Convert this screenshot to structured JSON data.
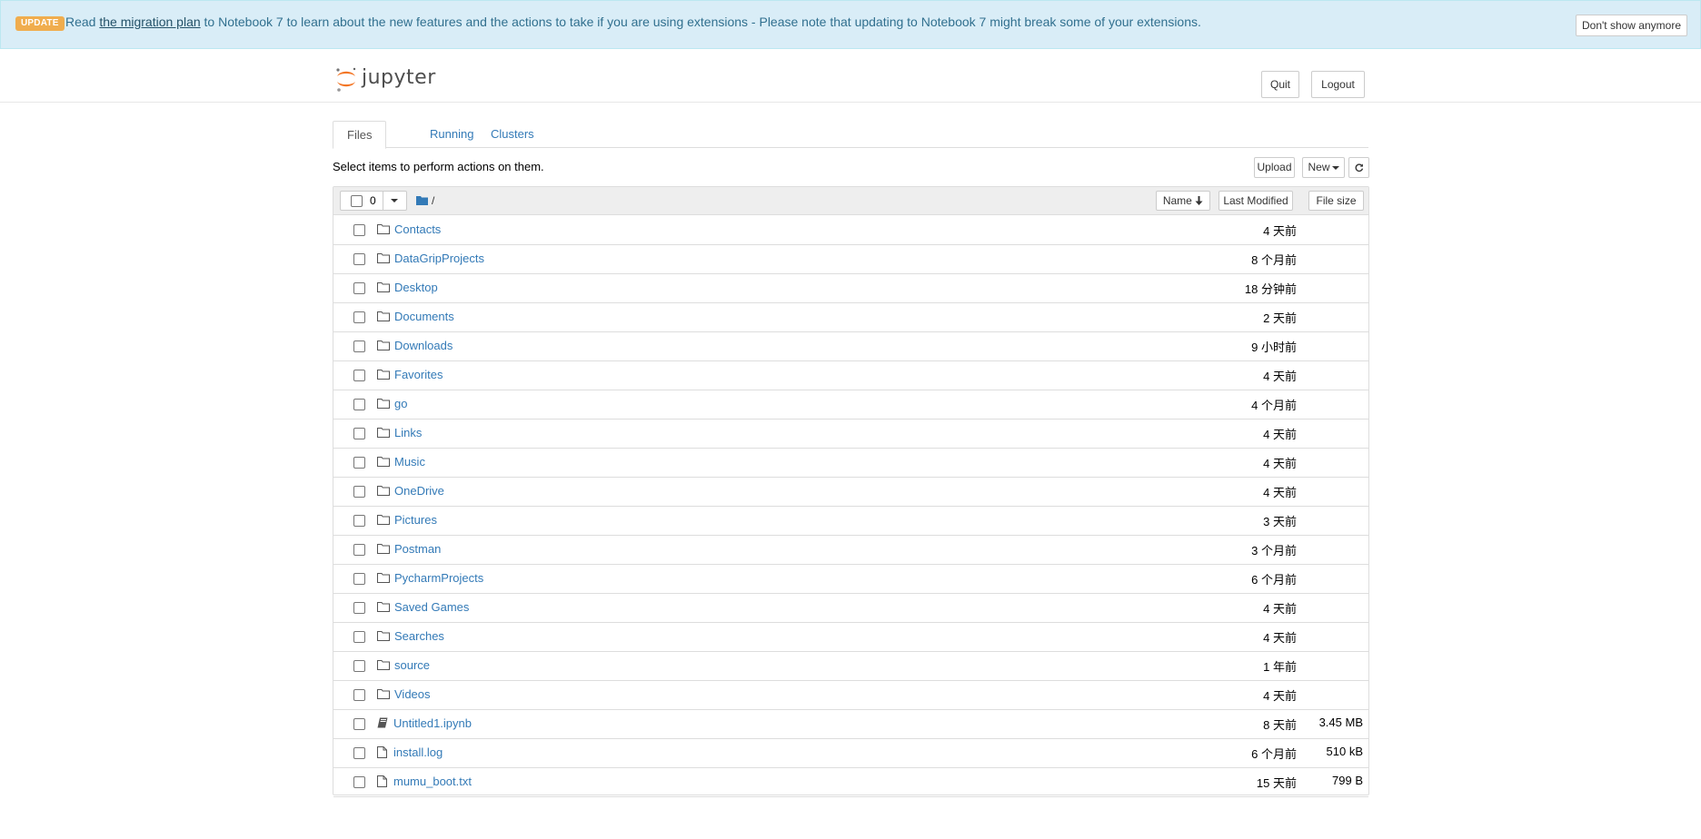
{
  "banner": {
    "badge": "UPDATE",
    "text_before": "Read ",
    "link": "the migration plan",
    "text_after": " to Notebook 7 to learn about the new features and the actions to take if you are using extensions - Please note that updating to Notebook 7 might break some of your extensions.",
    "dismiss": "Don't show anymore"
  },
  "header": {
    "logo_text": "jupyter",
    "quit": "Quit",
    "logout": "Logout"
  },
  "tabs": [
    {
      "label": "Files"
    },
    {
      "label": "Running"
    },
    {
      "label": "Clusters"
    }
  ],
  "toolbar": {
    "hint": "Select items to perform actions on them.",
    "upload": "Upload",
    "new": "New"
  },
  "list_header": {
    "selected_count": "0",
    "breadcrumb_root": "/",
    "sort_name": "Name",
    "sort_last_modified": "Last Modified",
    "sort_file_size": "File size"
  },
  "files": [
    {
      "name": "Contacts",
      "type": "folder",
      "modified": "4 天前",
      "size": ""
    },
    {
      "name": "DataGripProjects",
      "type": "folder",
      "modified": "8 个月前",
      "size": ""
    },
    {
      "name": "Desktop",
      "type": "folder",
      "modified": "18 分钟前",
      "size": ""
    },
    {
      "name": "Documents",
      "type": "folder",
      "modified": "2 天前",
      "size": ""
    },
    {
      "name": "Downloads",
      "type": "folder",
      "modified": "9 小时前",
      "size": ""
    },
    {
      "name": "Favorites",
      "type": "folder",
      "modified": "4 天前",
      "size": ""
    },
    {
      "name": "go",
      "type": "folder",
      "modified": "4 个月前",
      "size": ""
    },
    {
      "name": "Links",
      "type": "folder",
      "modified": "4 天前",
      "size": ""
    },
    {
      "name": "Music",
      "type": "folder",
      "modified": "4 天前",
      "size": ""
    },
    {
      "name": "OneDrive",
      "type": "folder",
      "modified": "4 天前",
      "size": ""
    },
    {
      "name": "Pictures",
      "type": "folder",
      "modified": "3 天前",
      "size": ""
    },
    {
      "name": "Postman",
      "type": "folder",
      "modified": "3 个月前",
      "size": ""
    },
    {
      "name": "PycharmProjects",
      "type": "folder",
      "modified": "6 个月前",
      "size": ""
    },
    {
      "name": "Saved Games",
      "type": "folder",
      "modified": "4 天前",
      "size": ""
    },
    {
      "name": "Searches",
      "type": "folder",
      "modified": "4 天前",
      "size": ""
    },
    {
      "name": "source",
      "type": "folder",
      "modified": "1 年前",
      "size": ""
    },
    {
      "name": "Videos",
      "type": "folder",
      "modified": "4 天前",
      "size": ""
    },
    {
      "name": "Untitled1.ipynb",
      "type": "notebook",
      "modified": "8 天前",
      "size": "3.45 MB"
    },
    {
      "name": "install.log",
      "type": "file",
      "modified": "6 个月前",
      "size": "510 kB"
    },
    {
      "name": "mumu_boot.txt",
      "type": "file",
      "modified": "15 天前",
      "size": "799 B"
    }
  ],
  "colors": {
    "link": "#337ab7",
    "banner_bg": "#d9edf7",
    "badge": "#f0ad4e",
    "logo_orange": "#f37626"
  }
}
